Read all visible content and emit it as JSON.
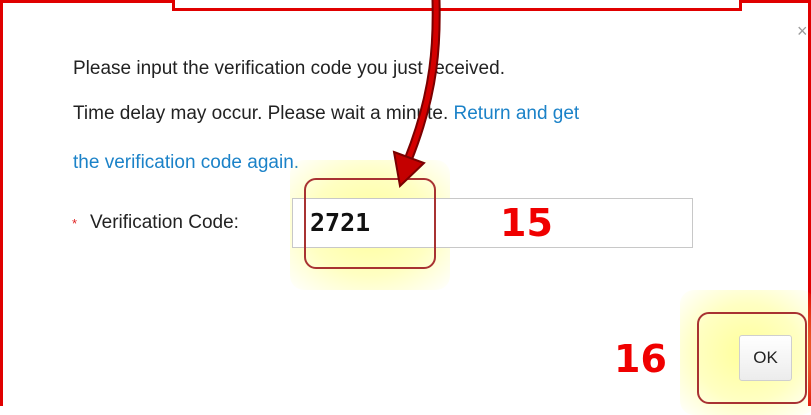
{
  "dialog": {
    "close_symbol": "×",
    "message_line1": "Please input the verification code you just received.",
    "message_line2": "Time delay may occur. Please wait a minute.",
    "link_part1": "Return and get",
    "link_part2": "the verification code again.",
    "required_marker": "*",
    "code_label": "Verification Code:",
    "code_value": "2721",
    "ok_label": "OK"
  },
  "annotations": {
    "step_code": "15",
    "step_ok": "16"
  },
  "colors": {
    "annotation_red": "#e00000",
    "link_blue": "#1b82c8",
    "highlight_yellow": "#ffff78"
  }
}
